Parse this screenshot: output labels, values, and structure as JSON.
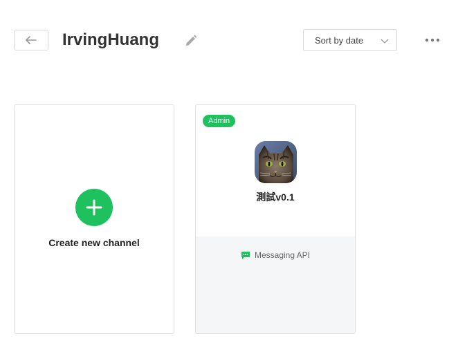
{
  "header": {
    "title": "IrvingHuang",
    "sort_label": "Sort by date"
  },
  "create_card": {
    "label": "Create new channel"
  },
  "channel": {
    "badge": "Admin",
    "name": "測試v0.1",
    "type_label": "Messaging API",
    "avatar_icon": "cat-photo-avatar"
  },
  "colors": {
    "accent_green": "#1ec15d",
    "footer_bg": "#f5f6f8"
  }
}
